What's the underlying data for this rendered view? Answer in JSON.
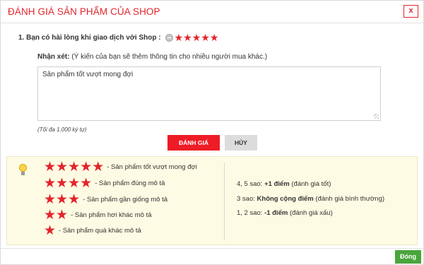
{
  "modal": {
    "title": "ĐÁNH GIÁ SẢN PHẨM CỦA SHOP",
    "close_label": "x"
  },
  "question": {
    "label": "1. Bạn có hài lòng khi giao dịch với Shop :",
    "rating": 5,
    "max_rating": 5
  },
  "comment": {
    "label": "Nhận xét:",
    "note": "(Ý kiến của bạn sẽ thêm thông tin cho nhiều người mua khác.)",
    "value": "Sản phẩm tốt vượt mong đợi",
    "hint": "(Tối đa 1.000 ký tự)"
  },
  "actions": {
    "submit_label": "ĐÁNH GIÁ",
    "cancel_label": "HỦY"
  },
  "legend": {
    "items": [
      {
        "stars": 5,
        "text": "- Sản phẩm tốt vượt mong đợi"
      },
      {
        "stars": 4,
        "text": "- Sản phẩm đúng mô tả"
      },
      {
        "stars": 3,
        "text": "- Sản phẩm gần giống mô tả"
      },
      {
        "stars": 2,
        "text": "- Sản phẩm hơi khác mô tả"
      },
      {
        "stars": 1,
        "text": "- Sản phẩm quá khác mô tả"
      }
    ],
    "rules": [
      {
        "prefix": "4, 5 sao: ",
        "bold": "+1 điểm",
        "suffix": " (đánh giá tốt)"
      },
      {
        "prefix": "3 sao: ",
        "bold": "Không cộng điểm",
        "suffix": " (đánh giá bình thường)"
      },
      {
        "prefix": "1, 2 sao: ",
        "bold": "-1 điểm",
        "suffix": " (đánh giá xấu)"
      }
    ]
  },
  "footer": {
    "close_label": "Đóng"
  },
  "colors": {
    "accent": "#e4242b",
    "submit": "#ee1c25",
    "close_button": "#4aa53c",
    "legend_bg": "#fdfbe3"
  },
  "icons": {
    "star": "star-icon",
    "bulb": "lightbulb-icon",
    "clear": "clear-rating-icon"
  }
}
